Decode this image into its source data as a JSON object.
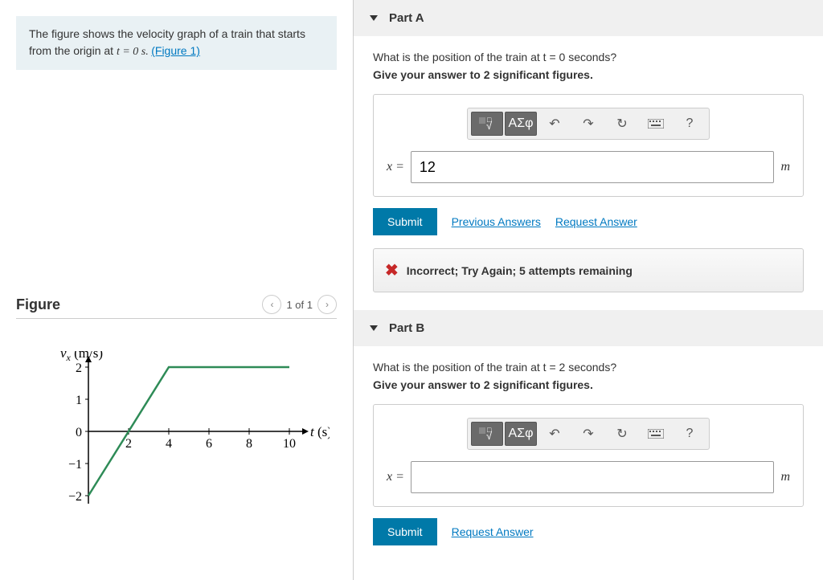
{
  "prompt": {
    "line1": "The figure shows the velocity graph of a train that starts from the origin at ",
    "eq": "t = 0 s. ",
    "figlink": "(Figure 1)"
  },
  "figure": {
    "title": "Figure",
    "counter": "1 of 1"
  },
  "chart_data": {
    "type": "line",
    "title": "",
    "xlabel": "t (s)",
    "ylabel": "v_x (m/s)",
    "xlim": [
      0,
      10
    ],
    "ylim": [
      -2,
      2
    ],
    "xticks": [
      2,
      4,
      6,
      8,
      10
    ],
    "yticks": [
      -2,
      -1,
      0,
      1,
      2
    ],
    "series": [
      {
        "name": "velocity",
        "x": [
          0,
          4,
          10
        ],
        "y": [
          -2,
          2,
          2
        ]
      }
    ]
  },
  "partA": {
    "header": "Part A",
    "question": "What is the position of the train at t = 0 seconds?",
    "instruct": "Give your answer to 2 significant figures.",
    "var": "x =",
    "value": "12",
    "unit": "m",
    "submit": "Submit",
    "prev": "Previous Answers",
    "req": "Request Answer",
    "feedback": "Incorrect; Try Again; 5 attempts remaining"
  },
  "partB": {
    "header": "Part B",
    "question": "What is the position of the train at t = 2 seconds?",
    "instruct": "Give your answer to 2 significant figures.",
    "var": "x =",
    "value": "",
    "unit": "m",
    "submit": "Submit",
    "req": "Request Answer"
  },
  "toolbar": {
    "greek": "ΑΣφ",
    "help": "?"
  }
}
